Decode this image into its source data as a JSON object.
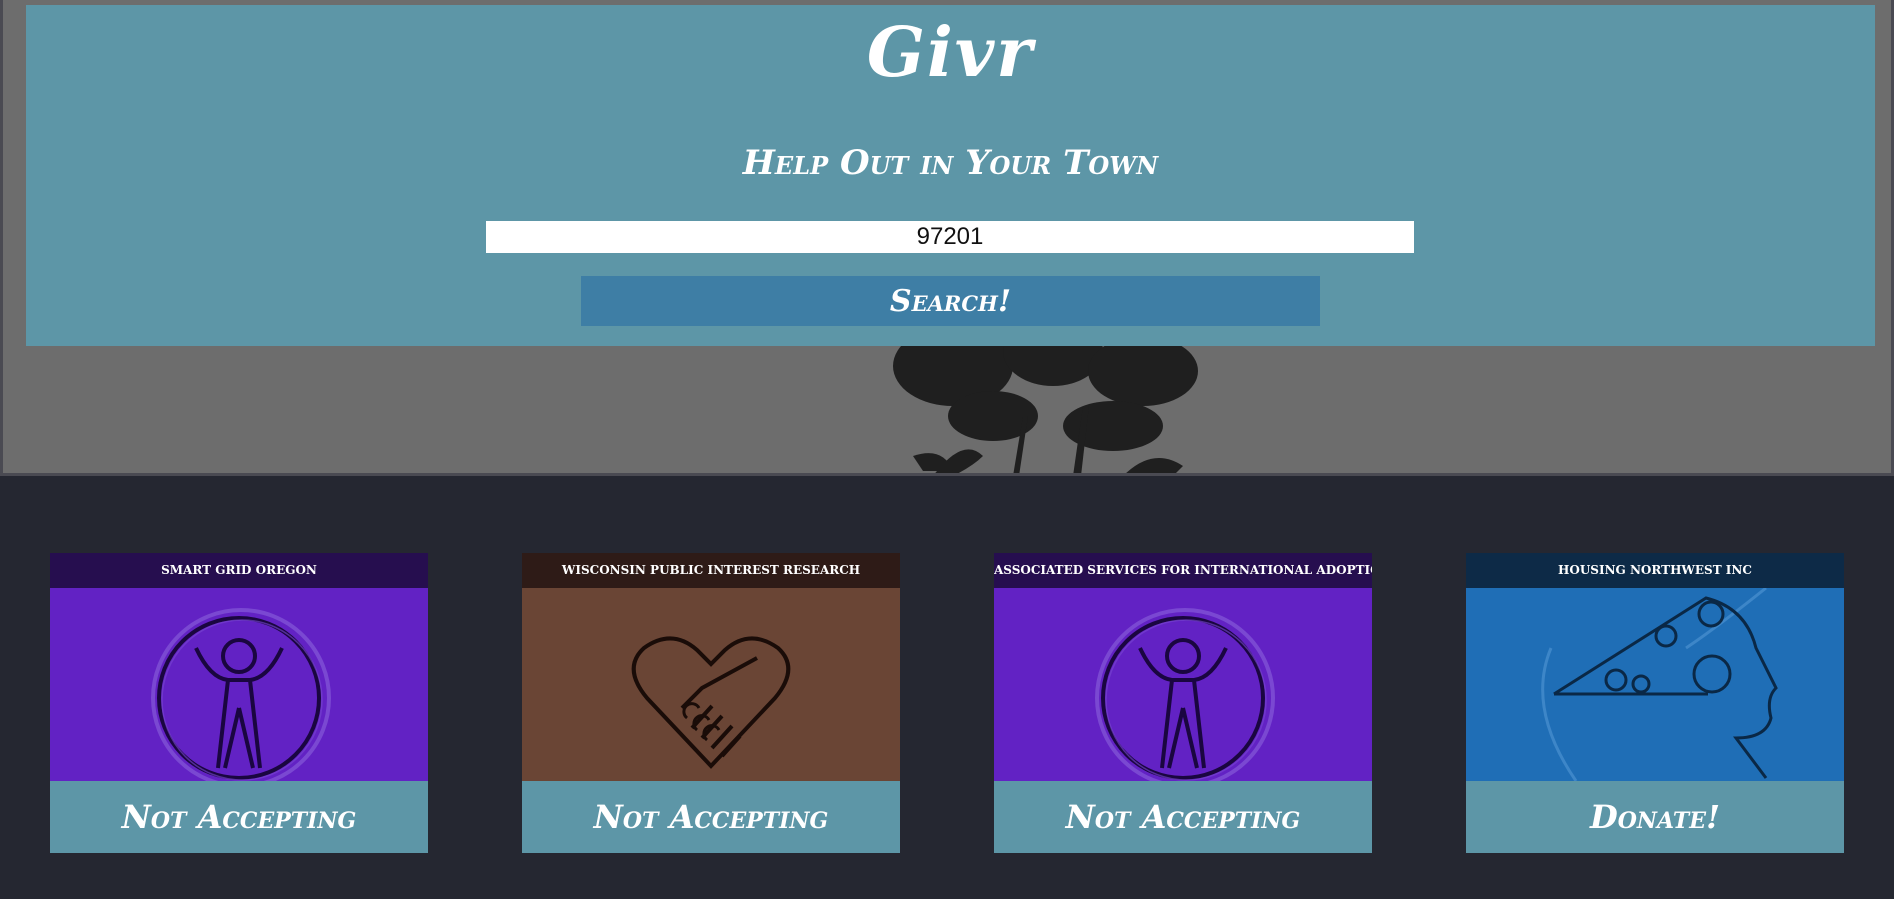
{
  "header": {
    "brand": "Givr",
    "tagline": "Help Out in Your Town",
    "zip_value": "97201",
    "search_label": "Search!"
  },
  "cards": [
    {
      "name": "SMART GRID OREGON",
      "action": "Not Accepting",
      "icon": "accessibility-icon",
      "header_color": "#260e4f",
      "body_color": "#6222c4"
    },
    {
      "name": "WISCONSIN PUBLIC INTEREST RESEARCH",
      "action": "Not Accepting",
      "icon": "heart-handshake-icon",
      "header_color": "#2e1b17",
      "body_color": "#6a4535"
    },
    {
      "name": "ASSOCIATED SERVICES FOR INTERNATIONAL ADOPTION",
      "action": "Not Accepting",
      "icon": "accessibility-icon",
      "header_color": "#260e4f",
      "body_color": "#6222c4"
    },
    {
      "name": "HOUSING NORTHWEST INC",
      "action": "Donate!",
      "icon": "head-gears-icon",
      "header_color": "#0d2a47",
      "body_color": "#1f6eb6"
    }
  ],
  "colors": {
    "page_bg": "#252731",
    "panel": "#5d96a7",
    "search_button": "#3e7ea5",
    "hero_bg": "#6d6d6d"
  }
}
